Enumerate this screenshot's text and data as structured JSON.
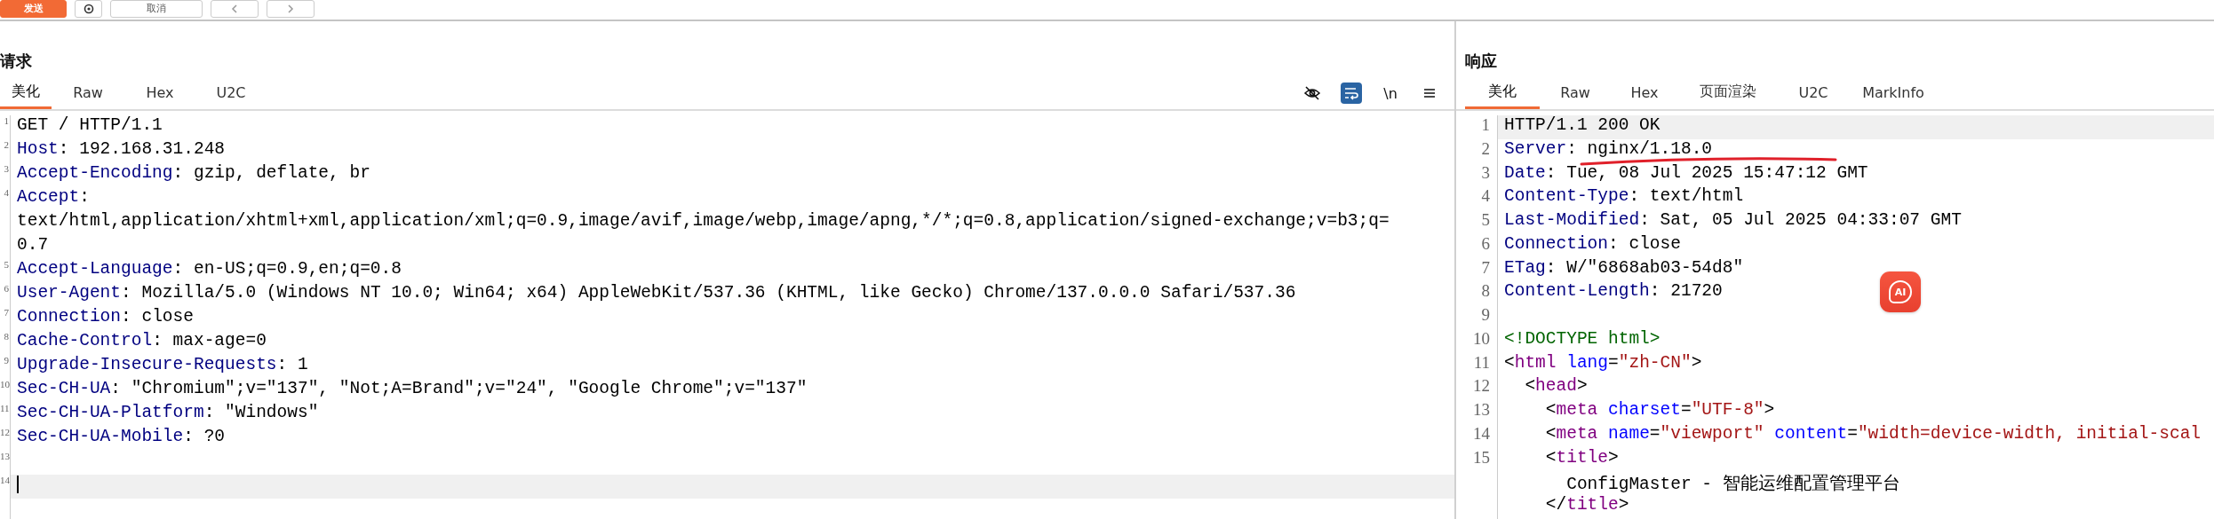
{
  "toolbar": {
    "buttons": [
      {
        "kind": "send",
        "label": "发送"
      },
      {
        "kind": "settings"
      },
      {
        "kind": "cancel",
        "label": "取消"
      },
      {
        "kind": "back"
      },
      {
        "kind": "forward"
      }
    ]
  },
  "request": {
    "title": "请求",
    "tabs": [
      {
        "label": "美化",
        "selected": true
      },
      {
        "label": "Raw",
        "selected": false
      },
      {
        "label": "Hex",
        "selected": false
      },
      {
        "label": "U2C",
        "selected": false
      }
    ],
    "tools": [
      {
        "kind": "hide",
        "selected": false
      },
      {
        "kind": "wrap",
        "selected": true
      },
      {
        "kind": "newline",
        "label": "\\n",
        "selected": false
      },
      {
        "kind": "menu"
      }
    ],
    "lines": [
      {
        "n": "1",
        "current": false,
        "segs": [
          {
            "kind": "plain",
            "t": "GET / HTTP/1.1"
          }
        ]
      },
      {
        "n": "2",
        "current": false,
        "segs": [
          {
            "kind": "name",
            "t": "Host"
          },
          {
            "kind": "plain",
            "t": ": 192.168.31.248"
          }
        ]
      },
      {
        "n": "3",
        "current": false,
        "segs": [
          {
            "kind": "name",
            "t": "Accept-Encoding"
          },
          {
            "kind": "plain",
            "t": ": gzip, deflate, br"
          }
        ]
      },
      {
        "n": "4",
        "current": false,
        "segs": [
          {
            "kind": "name",
            "t": "Accept"
          },
          {
            "kind": "plain",
            "t": ":"
          }
        ]
      },
      {
        "current": false,
        "segs": [
          {
            "kind": "plain",
            "t": "text/html,application/xhtml+xml,application/xml;q=0.9,image/avif,image/webp,image/apng,*/*;q=0.8,application/signed-exchange;v=b3;q="
          }
        ]
      },
      {
        "current": false,
        "segs": [
          {
            "kind": "plain",
            "t": "0.7"
          }
        ]
      },
      {
        "n": "5",
        "current": false,
        "segs": [
          {
            "kind": "name",
            "t": "Accept-Language"
          },
          {
            "kind": "plain",
            "t": ": en-US;q=0.9,en;q=0.8"
          }
        ]
      },
      {
        "n": "6",
        "current": false,
        "segs": [
          {
            "kind": "name",
            "t": "User-Agent"
          },
          {
            "kind": "plain",
            "t": ": Mozilla/5.0 (Windows NT 10.0; Win64; x64) AppleWebKit/537.36 (KHTML, like Gecko) Chrome/137.0.0.0 Safari/537.36"
          }
        ]
      },
      {
        "n": "7",
        "current": false,
        "segs": [
          {
            "kind": "name",
            "t": "Connection"
          },
          {
            "kind": "plain",
            "t": ": close"
          }
        ]
      },
      {
        "n": "8",
        "current": false,
        "segs": [
          {
            "kind": "name",
            "t": "Cache-Control"
          },
          {
            "kind": "plain",
            "t": ": max-age=0"
          }
        ]
      },
      {
        "n": "9",
        "current": false,
        "segs": [
          {
            "kind": "name",
            "t": "Upgrade-Insecure-Requests"
          },
          {
            "kind": "plain",
            "t": ": 1"
          }
        ]
      },
      {
        "n": "10",
        "current": false,
        "segs": [
          {
            "kind": "name",
            "t": "Sec-CH-UA"
          },
          {
            "kind": "plain",
            "t": ": \"Chromium\";v=\"137\", \"Not;A=Brand\";v=\"24\", \"Google Chrome\";v=\"137\""
          }
        ]
      },
      {
        "n": "11",
        "current": false,
        "segs": [
          {
            "kind": "name",
            "t": "Sec-CH-UA-Platform"
          },
          {
            "kind": "plain",
            "t": ": \"Windows\""
          }
        ]
      },
      {
        "n": "12",
        "current": false,
        "segs": [
          {
            "kind": "name",
            "t": "Sec-CH-UA-Mobile"
          },
          {
            "kind": "plain",
            "t": ": ?0"
          }
        ]
      },
      {
        "n": "13"
      },
      {
        "n": "14",
        "current": true
      }
    ]
  },
  "response": {
    "title": "响应",
    "tabs": [
      {
        "label": "美化",
        "selected": true
      },
      {
        "label": "Raw",
        "selected": false
      },
      {
        "label": "Hex",
        "selected": false
      },
      {
        "label": "页面渲染",
        "selected": false
      },
      {
        "label": "U2C",
        "selected": false
      },
      {
        "label": "MarkInfo",
        "selected": false
      }
    ],
    "lines": [
      {
        "n": "1",
        "current": true,
        "segs": [
          {
            "kind": "plain",
            "t": "HTTP/1.1 200 OK"
          }
        ]
      },
      {
        "n": "2",
        "current": false,
        "underlined": true,
        "segs": [
          {
            "kind": "name",
            "t": "Server"
          },
          {
            "kind": "plain",
            "t": ": nginx/1.18.0"
          }
        ]
      },
      {
        "n": "3",
        "current": false,
        "segs": [
          {
            "kind": "name",
            "t": "Date"
          },
          {
            "kind": "plain",
            "t": ": Tue, 08 Jul 2025 15:47:12 GMT"
          }
        ]
      },
      {
        "n": "4",
        "current": false,
        "segs": [
          {
            "kind": "name",
            "t": "Content-Type"
          },
          {
            "kind": "plain",
            "t": ": text/html"
          }
        ]
      },
      {
        "n": "5",
        "current": false,
        "segs": [
          {
            "kind": "name",
            "t": "Last-Modified"
          },
          {
            "kind": "plain",
            "t": ": Sat, 05 Jul 2025 04:33:07 GMT"
          }
        ]
      },
      {
        "n": "6",
        "current": false,
        "segs": [
          {
            "kind": "name",
            "t": "Connection"
          },
          {
            "kind": "plain",
            "t": ": close"
          }
        ]
      },
      {
        "n": "7",
        "current": false,
        "segs": [
          {
            "kind": "name",
            "t": "ETag"
          },
          {
            "kind": "plain",
            "t": ": W/\"6868ab03-54d8\""
          }
        ]
      },
      {
        "n": "8",
        "current": false,
        "segs": [
          {
            "kind": "name",
            "t": "Content-Length"
          },
          {
            "kind": "plain",
            "t": ": 21720"
          }
        ]
      },
      {
        "n": "9"
      },
      {
        "n": "10",
        "current": false,
        "segs": [
          {
            "kind": "doctype",
            "t": "<!DOCTYPE html>"
          }
        ]
      },
      {
        "n": "11",
        "current": false,
        "segs": [
          {
            "kind": "punct",
            "t": "<"
          },
          {
            "kind": "tag",
            "t": "html"
          },
          {
            "kind": "attr",
            "t": " lang"
          },
          {
            "kind": "punct",
            "t": "="
          },
          {
            "kind": "string",
            "t": "\"zh-CN\""
          },
          {
            "kind": "punct",
            "t": ">"
          }
        ]
      },
      {
        "n": "12",
        "current": false,
        "segs": [
          {
            "kind": "punct",
            "t": "  <"
          },
          {
            "kind": "tag",
            "t": "head"
          },
          {
            "kind": "punct",
            "t": ">"
          }
        ]
      },
      {
        "n": "13",
        "current": false,
        "segs": [
          {
            "kind": "punct",
            "t": "    <"
          },
          {
            "kind": "tag",
            "t": "meta"
          },
          {
            "kind": "attr",
            "t": " charset"
          },
          {
            "kind": "punct",
            "t": "="
          },
          {
            "kind": "string",
            "t": "\"UTF-8\""
          },
          {
            "kind": "punct",
            "t": ">"
          }
        ]
      },
      {
        "n": "14",
        "current": false,
        "segs": [
          {
            "kind": "punct",
            "t": "    <"
          },
          {
            "kind": "tag",
            "t": "meta"
          },
          {
            "kind": "attr",
            "t": " name"
          },
          {
            "kind": "punct",
            "t": "="
          },
          {
            "kind": "string",
            "t": "\"viewport\""
          },
          {
            "kind": "attr",
            "t": " content"
          },
          {
            "kind": "punct",
            "t": "="
          },
          {
            "kind": "string",
            "t": "\"width=device-width, initial-scal"
          }
        ]
      },
      {
        "n": "15",
        "current": false,
        "segs": [
          {
            "kind": "punct",
            "t": "    <"
          },
          {
            "kind": "tag",
            "t": "title"
          },
          {
            "kind": "punct",
            "t": ">"
          }
        ]
      },
      {
        "current": false,
        "segs": [
          {
            "kind": "plain",
            "t": "      ConfigMaster - 智能运维配置管理平台"
          }
        ]
      },
      {
        "current": false,
        "segs": [
          {
            "kind": "punct",
            "t": "    </"
          },
          {
            "kind": "tag",
            "t": "title"
          },
          {
            "kind": "punct",
            "t": ">"
          }
        ]
      }
    ]
  },
  "assistant": {
    "label": "AI"
  }
}
